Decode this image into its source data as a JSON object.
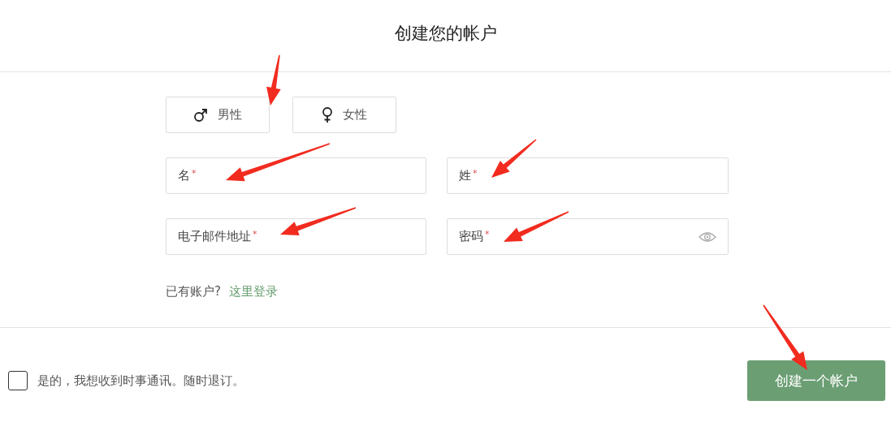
{
  "header": {
    "title": "创建您的帐户"
  },
  "gender_options": [
    {
      "kind": "male",
      "label": "男性",
      "selected": false
    },
    {
      "kind": "female",
      "label": "女性",
      "selected": false
    }
  ],
  "fields": [
    {
      "kind": "text",
      "label": "名",
      "marker": "*"
    },
    {
      "kind": "text",
      "label": "姓",
      "marker": "*"
    },
    {
      "kind": "text",
      "label": "电子邮件地址",
      "marker": "*"
    },
    {
      "kind": "password",
      "label": "密码",
      "marker": "*"
    }
  ],
  "login_prompt": {
    "text": "已有账户?",
    "link": "这里登录"
  },
  "newsletter": {
    "label": "是的，我想收到时事通讯。随时退订。",
    "checked": false
  },
  "submit_button": {
    "label": "创建一个帐户"
  }
}
